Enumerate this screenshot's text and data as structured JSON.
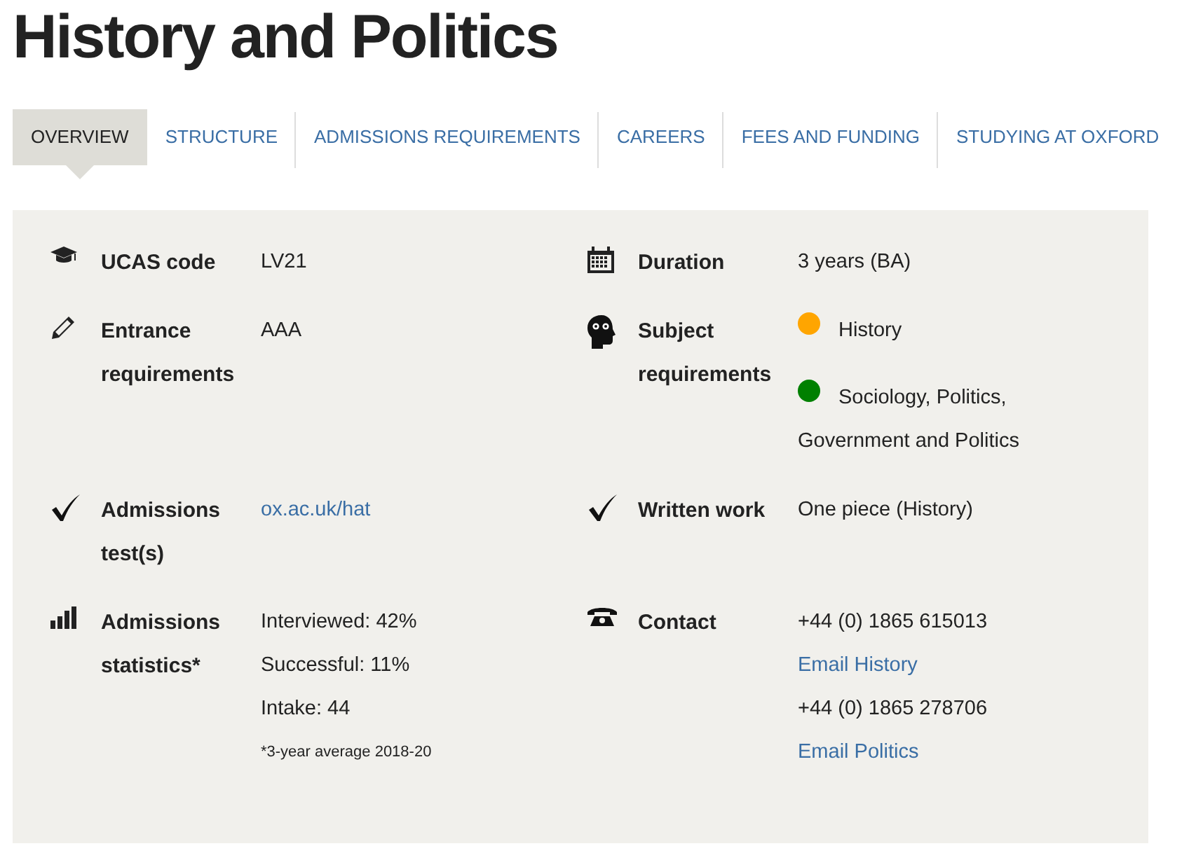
{
  "title": "History and Politics",
  "tabs": [
    {
      "label": "OVERVIEW",
      "selected": true
    },
    {
      "label": "STRUCTURE",
      "selected": false
    },
    {
      "label": "ADMISSIONS REQUIREMENTS",
      "selected": false
    },
    {
      "label": "CAREERS",
      "selected": false
    },
    {
      "label": "FEES AND FUNDING",
      "selected": false
    },
    {
      "label": "STUDYING AT OXFORD",
      "selected": false
    }
  ],
  "facts": [
    {
      "label": "UCAS code",
      "lines": [
        {
          "kind": "text",
          "text": "LV21"
        }
      ]
    },
    {
      "label": "Duration",
      "lines": [
        {
          "kind": "text",
          "text": "3 years (BA)"
        }
      ]
    },
    {
      "label": "Entrance requirements",
      "lines": [
        {
          "kind": "text",
          "text": "AAA"
        }
      ]
    },
    {
      "label": "Subject requirements",
      "lines": [
        {
          "kind": "subject",
          "text": "History",
          "color": "#ffa500"
        },
        {
          "kind": "subject",
          "text": "Sociology, Politics, Government and Politics",
          "color": "#008000"
        }
      ]
    },
    {
      "label": "Admissions test(s)",
      "lines": [
        {
          "kind": "link",
          "text": "ox.ac.uk/hat"
        }
      ]
    },
    {
      "label": "Written work",
      "lines": [
        {
          "kind": "text",
          "text": "One piece (History)"
        }
      ]
    },
    {
      "label": "Admissions statistics*",
      "lines": [
        {
          "kind": "text",
          "text": "Interviewed: 42%"
        },
        {
          "kind": "text",
          "text": "Successful: 11%"
        },
        {
          "kind": "text",
          "text": "Intake: 44"
        },
        {
          "kind": "note",
          "text": "*3-year average 2018-20"
        }
      ]
    },
    {
      "label": "Contact",
      "lines": [
        {
          "kind": "text",
          "text": "+44 (0) 1865 615013"
        },
        {
          "kind": "link",
          "text": "Email History"
        },
        {
          "kind": "text",
          "text": "+44 (0) 1865 278706"
        },
        {
          "kind": "link",
          "text": "Email Politics"
        }
      ]
    }
  ]
}
